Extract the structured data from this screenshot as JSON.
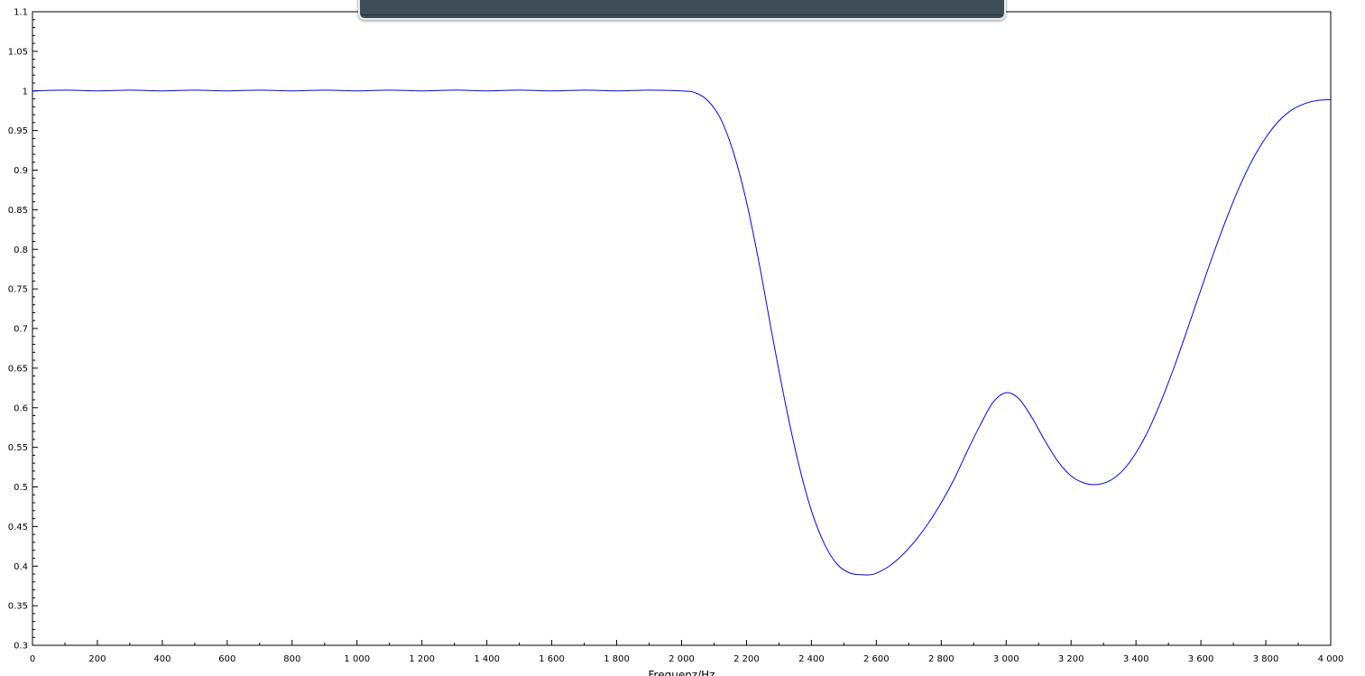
{
  "chart_data": {
    "type": "line",
    "title": "",
    "xlabel": "Frequenz/Hz",
    "ylabel": "",
    "xlim": [
      0,
      4000
    ],
    "ylim": [
      0.3,
      1.1
    ],
    "grid": false,
    "x_ticks": [
      0,
      200,
      400,
      600,
      800,
      1000,
      1200,
      1400,
      1600,
      1800,
      2000,
      2200,
      2400,
      2600,
      2800,
      3000,
      3200,
      3400,
      3600,
      3800,
      4000
    ],
    "x_tick_labels": [
      "0",
      "200",
      "400",
      "600",
      "800",
      "1 000",
      "1 200",
      "1 400",
      "1 600",
      "1 800",
      "2 000",
      "2 200",
      "2 400",
      "2 600",
      "2 800",
      "3 000",
      "3 200",
      "3 400",
      "3 600",
      "3 800",
      "4 000"
    ],
    "y_ticks": [
      0.3,
      0.35,
      0.4,
      0.45,
      0.5,
      0.55,
      0.6,
      0.65,
      0.7,
      0.75,
      0.8,
      0.85,
      0.9,
      0.95,
      1.0,
      1.05,
      1.1
    ],
    "y_tick_labels": [
      "0.3",
      "0.35",
      "0.4",
      "0.45",
      "0.5",
      "0.55",
      "0.6",
      "0.65",
      "0.7",
      "0.75",
      "0.8",
      "0.85",
      "0.9",
      "0.95",
      "1",
      "1.05",
      "1.1"
    ],
    "series": [
      {
        "color": "#0000ff",
        "x": [
          0,
          100,
          200,
          300,
          400,
          500,
          600,
          700,
          800,
          900,
          1000,
          1100,
          1200,
          1300,
          1400,
          1500,
          1600,
          1700,
          1800,
          1900,
          2000,
          2040,
          2080,
          2120,
          2160,
          2200,
          2240,
          2280,
          2320,
          2360,
          2400,
          2440,
          2480,
          2520,
          2560,
          2580,
          2600,
          2640,
          2680,
          2720,
          2760,
          2800,
          2840,
          2880,
          2920,
          2960,
          3000,
          3040,
          3080,
          3120,
          3160,
          3200,
          3240,
          3280,
          3320,
          3360,
          3400,
          3440,
          3480,
          3520,
          3560,
          3600,
          3640,
          3680,
          3720,
          3760,
          3800,
          3840,
          3880,
          3920,
          3960,
          4000
        ],
        "y": [
          1.0,
          1.001,
          1.0,
          1.001,
          1.0,
          1.001,
          1.0,
          1.001,
          1.0,
          1.001,
          1.0,
          1.001,
          1.0,
          1.001,
          1.0,
          1.001,
          1.0,
          1.001,
          1.0,
          1.001,
          1.0,
          0.998,
          0.988,
          0.965,
          0.922,
          0.86,
          0.78,
          0.69,
          0.605,
          0.53,
          0.47,
          0.428,
          0.402,
          0.391,
          0.389,
          0.389,
          0.391,
          0.4,
          0.414,
          0.432,
          0.454,
          0.48,
          0.51,
          0.545,
          0.578,
          0.607,
          0.619,
          0.611,
          0.587,
          0.558,
          0.532,
          0.514,
          0.505,
          0.503,
          0.508,
          0.521,
          0.543,
          0.573,
          0.611,
          0.654,
          0.701,
          0.749,
          0.796,
          0.84,
          0.88,
          0.914,
          0.941,
          0.962,
          0.976,
          0.984,
          0.988,
          0.989
        ]
      }
    ]
  }
}
